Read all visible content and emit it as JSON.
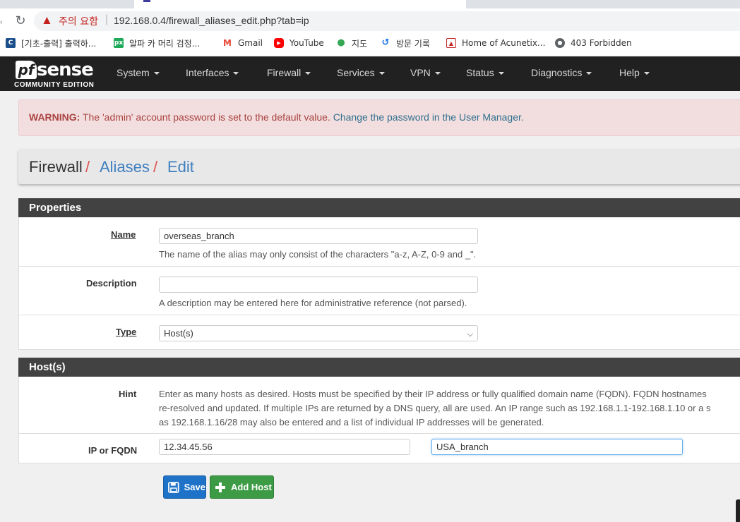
{
  "browser": {
    "security_label": "주의 요함",
    "url": "192.168.0.4/firewall_aliases_edit.php?tab=ip",
    "bookmarks": [
      {
        "label": "[기초-출력] 출력하...",
        "icon": "codeup-icon",
        "color": "#1a4f8b"
      },
      {
        "label": "알파 카 머리 검정...",
        "icon": "px-icon",
        "color": "#1faa59"
      },
      {
        "label": "Gmail",
        "icon": "gmail-icon",
        "color": "#ea4335"
      },
      {
        "label": "YouTube",
        "icon": "youtube-icon",
        "color": "#ff0000"
      },
      {
        "label": "지도",
        "icon": "maps-pin-icon",
        "color": "#34a853"
      },
      {
        "label": "방문 기록",
        "icon": "history-icon",
        "color": "#1a73e8"
      },
      {
        "label": "Home of Acunetix...",
        "icon": "acunetix-icon",
        "color": "#c62828"
      },
      {
        "label": "403 Forbidden",
        "icon": "globe-icon",
        "color": "#5f6368"
      }
    ]
  },
  "logo": {
    "brand_pf": "pf",
    "brand_sense": "sense",
    "edition": "COMMUNITY EDITION"
  },
  "nav": {
    "items": [
      "System",
      "Interfaces",
      "Firewall",
      "Services",
      "VPN",
      "Status",
      "Diagnostics",
      "Help"
    ]
  },
  "alert": {
    "strong": "WARNING:",
    "text": " The 'admin' account password is set to the default value. ",
    "link": "Change the password in the User Manager."
  },
  "breadcrumb": {
    "root": "Firewall",
    "sep": "/",
    "aliases": "Aliases",
    "edit": "Edit"
  },
  "properties": {
    "title": "Properties",
    "name_label": "Name",
    "name_value": "overseas_branch",
    "name_help": "The name of the alias may only consist of the characters \"a-z, A-Z, 0-9 and _\".",
    "description_label": "Description",
    "description_value": "",
    "description_help": "A description may be entered here for administrative reference (not parsed).",
    "type_label": "Type",
    "type_value": "Host(s)"
  },
  "hosts": {
    "title": "Host(s)",
    "hint_label": "Hint",
    "hint_line1": "Enter as many hosts as desired. Hosts must be specified by their IP address or fully qualified domain name (FQDN). FQDN hostnames",
    "hint_line2": "re-resolved and updated. If multiple IPs are returned by a DNS query, all are used. An IP range such as 192.168.1.1-192.168.1.10 or a s",
    "hint_line3": "as 192.168.1.16/28 may also be entered and a list of individual IP addresses will be generated.",
    "ip_label": "IP or FQDN",
    "ip_value": "12.34.45.56",
    "desc_value": "USA_branch"
  },
  "buttons": {
    "save": "Save",
    "add_host": "Add Host"
  },
  "colors": {
    "navbar": "#212121",
    "panel_head": "#424242",
    "save": "#1e73c9",
    "add": "#3c9b44",
    "alert_bg": "#f2dede",
    "link": "#3f7fc0"
  }
}
